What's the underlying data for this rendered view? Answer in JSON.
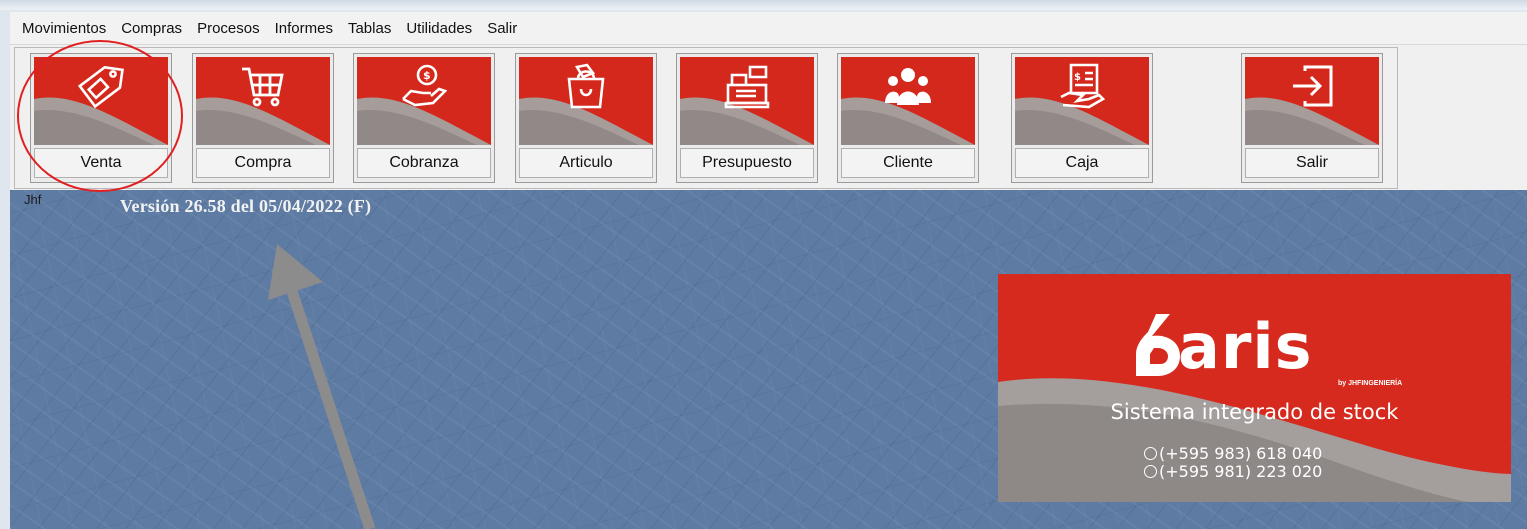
{
  "menu": {
    "items": [
      "Movimientos",
      "Compras",
      "Procesos",
      "Informes",
      "Tablas",
      "Utilidades",
      "Salir"
    ]
  },
  "toolbar": {
    "buttons": [
      {
        "label": "Venta",
        "icon": "price-tag-icon"
      },
      {
        "label": "Compra",
        "icon": "shopping-cart-icon"
      },
      {
        "label": "Cobranza",
        "icon": "hand-coin-icon"
      },
      {
        "label": "Articulo",
        "icon": "shopping-bag-icon"
      },
      {
        "label": "Presupuesto",
        "icon": "cash-register-icon"
      },
      {
        "label": "Cliente",
        "icon": "people-group-icon"
      },
      {
        "label": "Caja",
        "icon": "invoice-hand-icon"
      },
      {
        "label": "Salir",
        "icon": "exit-icon"
      }
    ]
  },
  "status": {
    "user": "Jhf",
    "version": "Versión 26.58 del 05/04/2022  (F)"
  },
  "logo": {
    "brand": "aris",
    "by_line": "by JHFINGENIERÍA",
    "tagline": "Sistema integrado de stock",
    "phones": [
      "(+595 983) 618 040",
      "(+595 981) 223 020"
    ]
  },
  "colors": {
    "brand_red": "#d4281c",
    "desktop_blue": "#5e7ba3",
    "annotation_red": "#e02020",
    "arrow_gray": "#8c8c8c"
  }
}
